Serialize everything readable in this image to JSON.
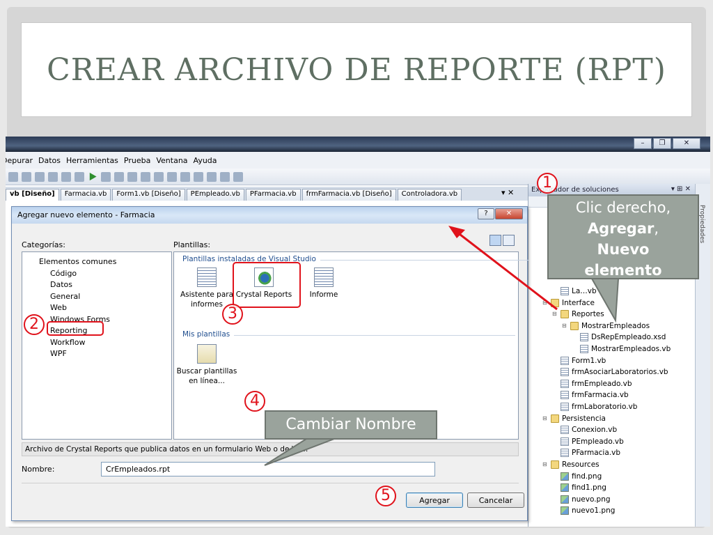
{
  "slide": {
    "title": "CREAR ARCHIVO DE REPORTE (RPT)"
  },
  "ide": {
    "window_buttons": [
      "–",
      "❐",
      "✕"
    ],
    "menu": [
      "Depurar",
      "Datos",
      "Herramientas",
      "Prueba",
      "Ventana",
      "Ayuda"
    ],
    "tabs": [
      {
        "label": "vb [Diseño]",
        "active": true
      },
      {
        "label": "Farmacia.vb",
        "active": false
      },
      {
        "label": "Form1.vb [Diseño]",
        "active": false
      },
      {
        "label": "PEmpleado.vb",
        "active": false
      },
      {
        "label": "PFarmacia.vb",
        "active": false
      },
      {
        "label": "frmFarmacia.vb [Diseño]",
        "active": false
      },
      {
        "label": "Controladora.vb",
        "active": false
      }
    ],
    "tabs_controls": "▾ ✕"
  },
  "solution_explorer": {
    "title": "Explorador de soluciones",
    "controls": "▾ ⊞ ✕",
    "side_label": "Propiedades",
    "items": [
      {
        "label": "La…vb",
        "type": "file",
        "depth": 2
      },
      {
        "label": "Interface",
        "type": "folder",
        "depth": 1
      },
      {
        "label": "Reportes",
        "type": "folder",
        "depth": 2
      },
      {
        "label": "MostrarEmpleados",
        "type": "folder",
        "depth": 3
      },
      {
        "label": "DsRepEmpleado.xsd",
        "type": "file",
        "depth": 4
      },
      {
        "label": "MostrarEmpleados.vb",
        "type": "file",
        "depth": 4
      },
      {
        "label": "Form1.vb",
        "type": "file",
        "depth": 2
      },
      {
        "label": "frmAsociarLaboratorios.vb",
        "type": "file",
        "depth": 2
      },
      {
        "label": "frmEmpleado.vb",
        "type": "file",
        "depth": 2
      },
      {
        "label": "frmFarmacia.vb",
        "type": "file",
        "depth": 2
      },
      {
        "label": "frmLaboratorio.vb",
        "type": "file",
        "depth": 2
      },
      {
        "label": "Persistencia",
        "type": "folder",
        "depth": 1
      },
      {
        "label": "Conexion.vb",
        "type": "file",
        "depth": 2
      },
      {
        "label": "PEmpleado.vb",
        "type": "file",
        "depth": 2
      },
      {
        "label": "PFarmacia.vb",
        "type": "file",
        "depth": 2
      },
      {
        "label": "Resources",
        "type": "folder",
        "depth": 1
      },
      {
        "label": "find.png",
        "type": "img",
        "depth": 2
      },
      {
        "label": "find1.png",
        "type": "img",
        "depth": 2
      },
      {
        "label": "nuevo.png",
        "type": "img",
        "depth": 2
      },
      {
        "label": "nuevo1.png",
        "type": "img",
        "depth": 2
      }
    ]
  },
  "dialog": {
    "title": "Agregar nuevo elemento - Farmacia",
    "help_button": "?",
    "close_button": "✕",
    "categories_label": "Categorías:",
    "templates_label": "Plantillas:",
    "categories": [
      {
        "label": "Elementos comunes",
        "depth": 0,
        "selected": false
      },
      {
        "label": "Código",
        "depth": 1,
        "selected": false
      },
      {
        "label": "Datos",
        "depth": 1,
        "selected": false
      },
      {
        "label": "General",
        "depth": 1,
        "selected": false
      },
      {
        "label": "Web",
        "depth": 1,
        "selected": false
      },
      {
        "label": "Windows Forms",
        "depth": 1,
        "selected": false
      },
      {
        "label": "Reporting",
        "depth": 1,
        "selected": true
      },
      {
        "label": "Workflow",
        "depth": 1,
        "selected": false
      },
      {
        "label": "WPF",
        "depth": 1,
        "selected": false
      }
    ],
    "installed_section": "Plantillas instaladas de Visual Studio",
    "installed_templates": [
      {
        "label": "Asistente para informes",
        "icon": "report-wizard-icon"
      },
      {
        "label": "Crystal Reports",
        "icon": "crystal-reports-icon"
      },
      {
        "label": "Informe",
        "icon": "report-icon"
      }
    ],
    "my_section": "Mis plantillas",
    "my_templates": [
      {
        "label": "Buscar plantillas en línea...",
        "icon": "search-templates-icon"
      }
    ],
    "description": "Archivo de Crystal Reports que publica datos en un formulario Web o de Wi…",
    "name_label": "Nombre:",
    "name_value": "CrEmpleados.rpt",
    "add_button": "Agregar",
    "cancel_button": "Cancelar"
  },
  "annotations": {
    "steps": [
      "1",
      "2",
      "3",
      "4",
      "5"
    ],
    "callout_1": [
      "Clic derecho,",
      "Agregar",
      ",",
      "Nuevo",
      "elemento"
    ],
    "callout_2": "Cambiar Nombre",
    "highlight_color": "#e0121b",
    "callout_color": "#9aa39c"
  }
}
